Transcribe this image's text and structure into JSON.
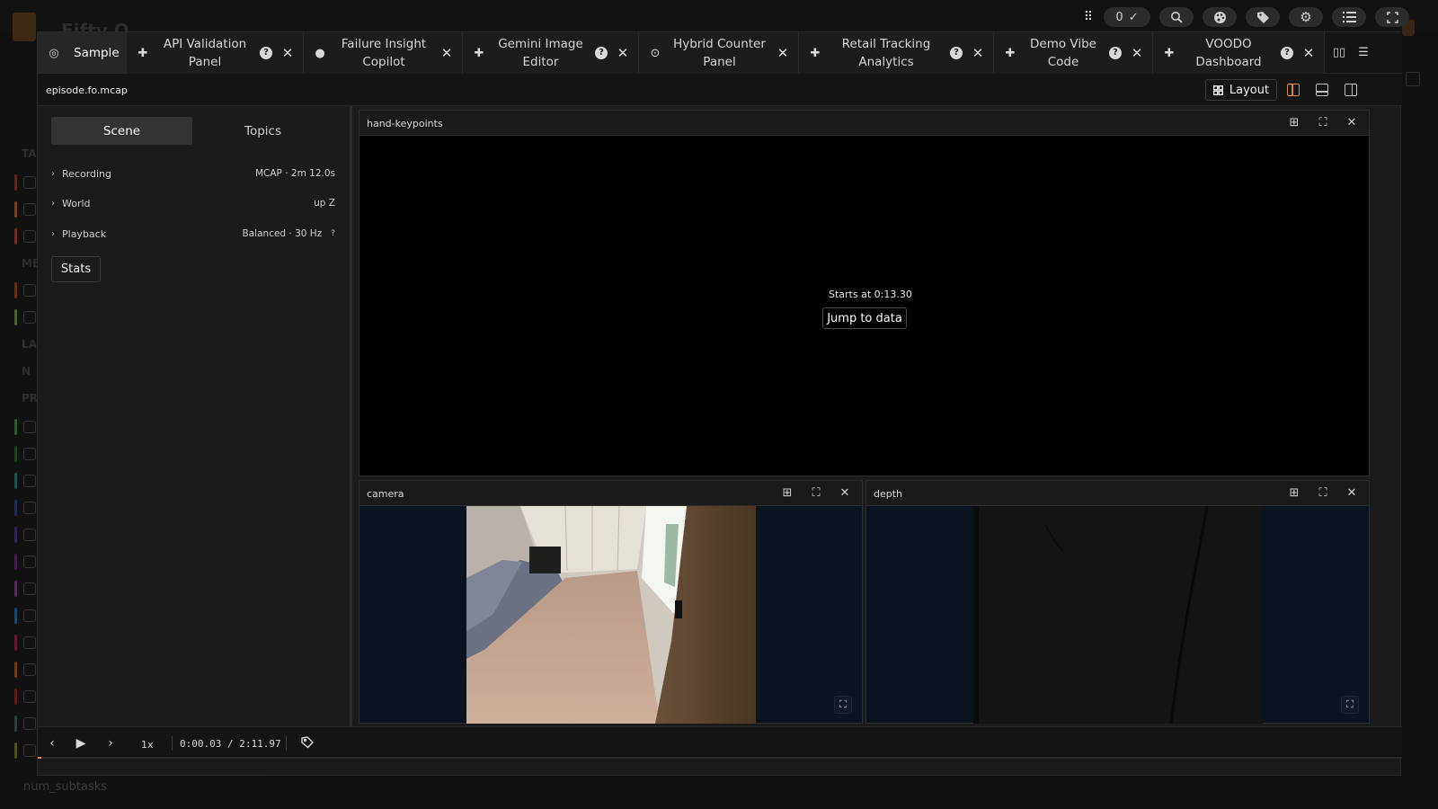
{
  "toolbar": {
    "counter": "0"
  },
  "tabs": [
    {
      "label": "Sample",
      "active": true,
      "icon": "scan-icon"
    },
    {
      "label": "API Validation Panel",
      "icon": "plugin-icon"
    },
    {
      "label": "Failure Insight Copilot",
      "icon": "bulb-icon"
    },
    {
      "label": "Gemini Image Editor",
      "icon": "plugin-icon"
    },
    {
      "label": "Hybrid Counter Panel",
      "icon": "target-icon"
    },
    {
      "label": "Retail Tracking Analytics",
      "icon": "plugin-icon"
    },
    {
      "label": "Demo Vibe Code",
      "icon": "plugin-icon"
    },
    {
      "label": "VOODO Dashboard",
      "icon": "plugin-icon"
    }
  ],
  "file": {
    "name": "episode.fo.mcap"
  },
  "layout_button": {
    "label": "Layout"
  },
  "left": {
    "tabs": [
      "Scene",
      "Topics"
    ],
    "rows": [
      {
        "name": "Recording",
        "value": "MCAP · 2m 12.0s"
      },
      {
        "name": "World",
        "value": "up Z"
      },
      {
        "name": "Playback",
        "value": "Balanced · 30 Hz",
        "hint": "?"
      }
    ],
    "stats_label": "Stats"
  },
  "panels": {
    "hand": {
      "title": "hand-keypoints",
      "message": "Starts at 0:13.30",
      "jump_label": "Jump to data"
    },
    "camera": {
      "title": "camera"
    },
    "depth": {
      "title": "depth"
    }
  },
  "timeline": {
    "speed": "1x",
    "time": "0:00.03 / 2:11.97",
    "progress": 0.0004
  },
  "background": {
    "title": "Fifty O",
    "groups": [
      "TA",
      "ME",
      "LA",
      "N",
      "PR"
    ],
    "bottom_item": "num_subtasks"
  },
  "colors": {
    "accent": "#e08a2a"
  }
}
